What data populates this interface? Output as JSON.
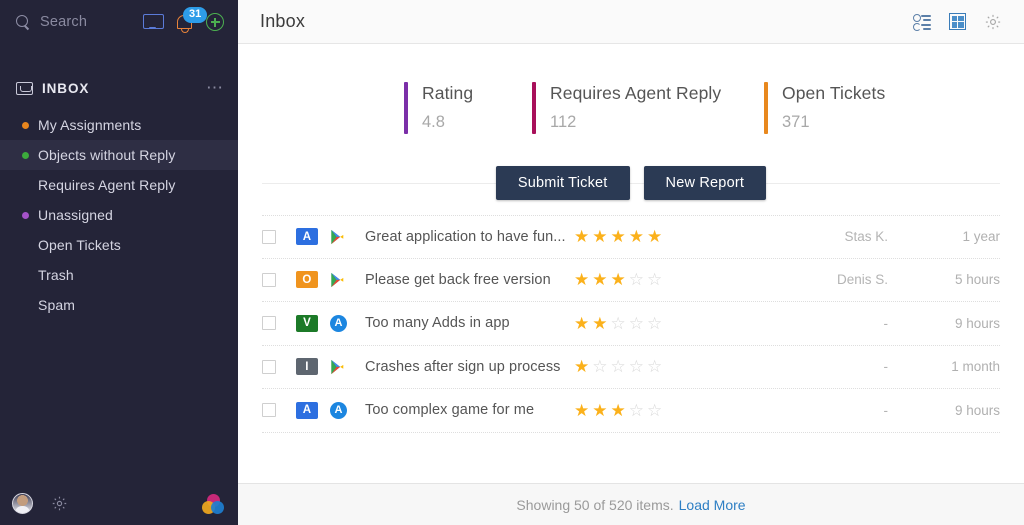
{
  "sidebar": {
    "search": {
      "placeholder": "Search",
      "value": "",
      "icon": "search-icon"
    },
    "top_icons": [
      {
        "name": "monitor-icon",
        "label": ""
      },
      {
        "name": "bell-icon",
        "label": ""
      },
      {
        "name": "plus-icon",
        "label": ""
      }
    ],
    "notification_badge": "31",
    "section": {
      "label": "INBOX",
      "icon": "inbox-icon",
      "more_icon": "more-options-icon"
    },
    "items": [
      {
        "label": "My Assignments",
        "dot": "#e8861e",
        "active": false
      },
      {
        "label": "Objects without Reply",
        "dot": "#3cab3c",
        "active": true
      },
      {
        "label": "Requires Agent Reply",
        "dot": "",
        "active": false
      },
      {
        "label": "Unassigned",
        "dot": "#a452c8",
        "active": false
      },
      {
        "label": "Open Tickets",
        "dot": "",
        "active": false
      },
      {
        "label": "Trash",
        "dot": "",
        "active": false
      },
      {
        "label": "Spam",
        "dot": "",
        "active": false
      }
    ],
    "bottom": {
      "avatar": "user-avatar",
      "settings_icon": "gear-icon",
      "brand_logo": "brand-logo"
    }
  },
  "header": {
    "title": "Inbox",
    "icons": [
      {
        "name": "list-filter-icon"
      },
      {
        "name": "grid-view-icon"
      },
      {
        "name": "gear-icon"
      }
    ]
  },
  "stats": [
    {
      "label": "Rating",
      "value": "4.8",
      "color": "#7b2fa8"
    },
    {
      "label": "Requires Agent Reply",
      "value": "112",
      "color": "#a8105a"
    },
    {
      "label": "Open Tickets",
      "value": "371",
      "color": "#e8881e"
    }
  ],
  "toolbar": {
    "submit_ticket_label": "Submit Ticket",
    "new_report_label": "New Report"
  },
  "table": {
    "rows": [
      {
        "checked": false,
        "badge": {
          "letter": "A",
          "color": "#2d6fe0"
        },
        "store": "google-play-icon",
        "title": "Great application to have fun...",
        "rating": 5,
        "author": "Stas K.",
        "time": "1 year"
      },
      {
        "checked": false,
        "badge": {
          "letter": "O",
          "color": "#f0941e"
        },
        "store": "google-play-icon",
        "title": "Please get back free version",
        "rating": 3,
        "author": "Denis S.",
        "time": "5 hours"
      },
      {
        "checked": false,
        "badge": {
          "letter": "V",
          "color": "#1c7a28"
        },
        "store": "app-store-icon",
        "title": "Too many Adds in app",
        "rating": 2,
        "author": "-",
        "time": "9 hours"
      },
      {
        "checked": false,
        "badge": {
          "letter": "I",
          "color": "#5e6670"
        },
        "store": "google-play-icon",
        "title": "Crashes after sign up process",
        "rating": 1,
        "author": "-",
        "time": "1 month"
      },
      {
        "checked": false,
        "badge": {
          "letter": "A",
          "color": "#2d6fe0"
        },
        "store": "app-store-icon",
        "title": "Too complex game for me",
        "rating": 3,
        "author": "-",
        "time": "9 hours"
      }
    ],
    "max_stars": 5
  },
  "footer": {
    "text": "Showing 50 of 520 items.",
    "load_more_label": "Load More"
  }
}
